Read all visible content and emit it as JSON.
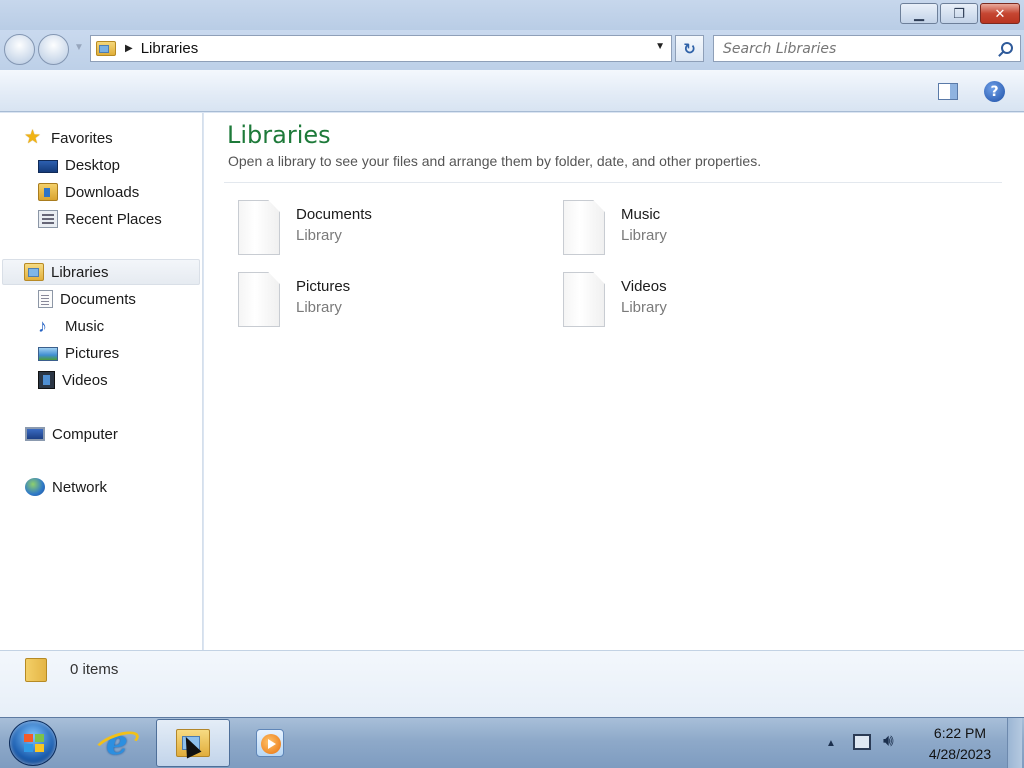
{
  "window": {
    "minimize_label": "▁",
    "maximize_label": "❐",
    "close_label": "✕"
  },
  "address": {
    "path": "Libraries",
    "refresh_label": "↻"
  },
  "search": {
    "placeholder": "Search Libraries"
  },
  "toolbar": {
    "help_label": "?"
  },
  "navigation": {
    "favorites": {
      "label": "Favorites",
      "icon": "star-icon",
      "items": [
        {
          "label": "Desktop",
          "icon": "desktop-icon"
        },
        {
          "label": "Downloads",
          "icon": "downloads-icon"
        },
        {
          "label": "Recent Places",
          "icon": "recent-places-icon"
        }
      ]
    },
    "libraries": {
      "label": "Libraries",
      "icon": "libraries-icon",
      "selected": true,
      "items": [
        {
          "label": "Documents",
          "icon": "documents-icon"
        },
        {
          "label": "Music",
          "icon": "music-icon"
        },
        {
          "label": "Pictures",
          "icon": "pictures-icon"
        },
        {
          "label": "Videos",
          "icon": "videos-icon"
        }
      ]
    },
    "computer": {
      "label": "Computer",
      "icon": "computer-icon"
    },
    "network": {
      "label": "Network",
      "icon": "network-icon"
    }
  },
  "content": {
    "title": "Libraries",
    "subtitle": "Open a library to see your files and arrange them by folder, date, and other properties.",
    "libraries": [
      {
        "name": "Documents",
        "type": "Library"
      },
      {
        "name": "Music",
        "type": "Library"
      },
      {
        "name": "Pictures",
        "type": "Library"
      },
      {
        "name": "Videos",
        "type": "Library"
      }
    ]
  },
  "details": {
    "item_count": "0 items"
  },
  "taskbar": {
    "pinned": [
      {
        "name": "Internet Explorer",
        "icon": "internet-explorer-icon"
      },
      {
        "name": "Windows Explorer",
        "icon": "explorer-icon",
        "active": true
      },
      {
        "name": "Windows Media Player",
        "icon": "media-player-icon"
      }
    ],
    "time": "6:22 PM",
    "date": "4/28/2023"
  },
  "colors": {
    "title_green": "#1e7a3a",
    "taskbar_blue": "#8ea9c9",
    "close_red": "#c54632"
  }
}
